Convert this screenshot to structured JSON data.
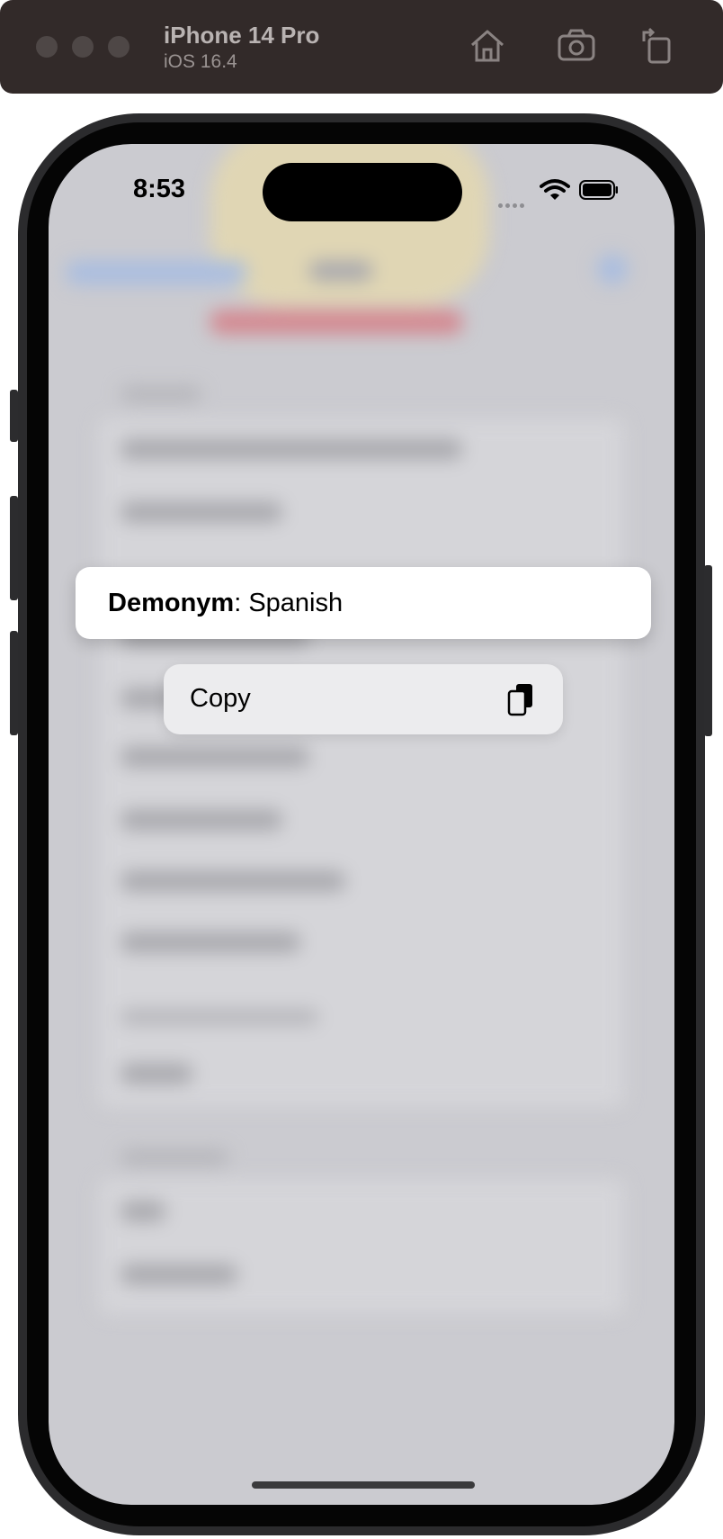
{
  "simulator": {
    "device_name": "iPhone 14 Pro",
    "os_version": "iOS 16.4",
    "icons": [
      "home-icon",
      "screenshot-icon",
      "rotate-icon"
    ]
  },
  "status_bar": {
    "time": "8:53",
    "icons": [
      "cellular-signal-icon",
      "wifi-icon",
      "battery-icon"
    ]
  },
  "context_preview": {
    "label": "Demonym",
    "separator": ":",
    "value": " Spanish"
  },
  "context_menu": {
    "items": [
      {
        "label": "Copy",
        "icon": "copy-icon"
      }
    ]
  },
  "colors": {
    "simulator_bar": "#322a29",
    "screen_background": "#cbcbd0",
    "menu_background": "#ececee"
  }
}
